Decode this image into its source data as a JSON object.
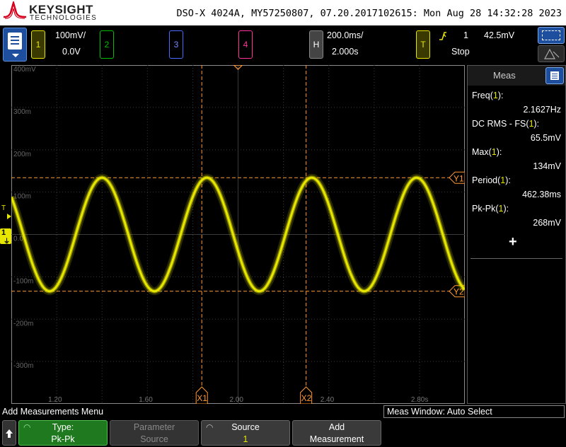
{
  "header": {
    "brand": "KEYSIGHT",
    "brand_sub": "TECHNOLOGIES",
    "title_line": "DSO-X 4024A, MY57250807, 07.20.2017102615: Mon Aug 28 14:32:28 2023"
  },
  "channels": [
    {
      "number": "1",
      "scale": "100mV/",
      "offset": "0.0V",
      "color": "#e6e600"
    },
    {
      "number": "2",
      "color": "#00c000"
    },
    {
      "number": "3",
      "color": "#4a6bff"
    },
    {
      "number": "4",
      "color": "#ff3399"
    }
  ],
  "horizontal": {
    "label": "H",
    "timebase": "200.0ms/",
    "position": "2.000s"
  },
  "trigger": {
    "label": "T",
    "source": "1",
    "level": "42.5mV",
    "status": "Stop"
  },
  "y_axis_labels": [
    "400mV",
    "300m",
    "200m",
    "100m",
    "0.0",
    "-100m",
    "-200m",
    "-300m"
  ],
  "x_axis_labels": [
    "1.20",
    "1.60",
    "2.00",
    "2.40",
    "2.80s"
  ],
  "cursors": {
    "x1": "X1",
    "x2": "X2",
    "y1": "Y1",
    "y2": "Y2",
    "ground_marker": "1"
  },
  "waveform": {
    "type": "sine",
    "frequency_hz": 2.1627,
    "amplitude_mv": 134,
    "color": "#e6e600",
    "time_start_s": 1.0,
    "time_end_s": 3.0,
    "peak_times_s": [
      1.4,
      1.86,
      2.32,
      2.78
    ]
  },
  "meas_panel": {
    "title": "Meas",
    "items": [
      {
        "label_pre": "Freq(",
        "ch": "1",
        "label_post": "):",
        "value": "2.1627Hz"
      },
      {
        "label_pre": "DC RMS - FS(",
        "ch": "1",
        "label_post": "):",
        "value": "65.5mV"
      },
      {
        "label_pre": "Max(",
        "ch": "1",
        "label_post": "):",
        "value": "134mV"
      },
      {
        "label_pre": "Period(",
        "ch": "1",
        "label_post": "):",
        "value": "462.38ms"
      },
      {
        "label_pre": "Pk-Pk(",
        "ch": "1",
        "label_post": "):",
        "value": "268mV"
      }
    ],
    "add_symbol": "+"
  },
  "menu": {
    "title": "Add Measurements Menu",
    "meas_window": "Meas Window: Auto Select"
  },
  "softkeys": {
    "type": {
      "line1": "Type:",
      "line2": "Pk-Pk"
    },
    "parameter": {
      "line1": "Parameter",
      "line2": "Source"
    },
    "source": {
      "line1": "Source",
      "line2": "1"
    },
    "add": {
      "line1": "Add",
      "line2": "Measurement"
    }
  }
}
